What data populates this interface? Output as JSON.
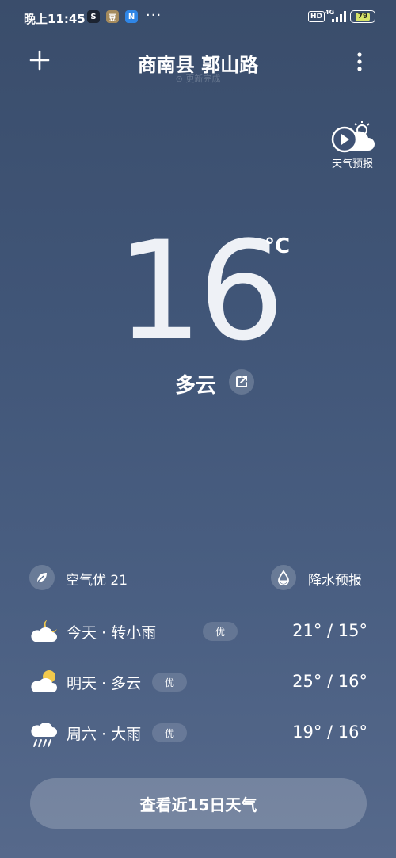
{
  "status_bar": {
    "time": "晚上11:45",
    "app_icons": [
      "S",
      "豆",
      "N"
    ],
    "more": "···",
    "hd": "HD",
    "network": "4G",
    "battery": "79"
  },
  "header": {
    "add_icon": "plus-icon",
    "title": "商南县 郭山路",
    "subtitle": "⊙ 更新完成",
    "more_icon": "more-vertical-icon"
  },
  "forecast_video": {
    "label": "天气预报",
    "icon": "play-weather-icon"
  },
  "current": {
    "temperature": "16",
    "unit": "°C",
    "condition": "多云"
  },
  "air_quality": {
    "label": "空气优 21",
    "icon": "leaf-icon"
  },
  "precipitation": {
    "label": "降水预报",
    "icon": "drop-icon"
  },
  "daily": [
    {
      "label": "今天 · 转小雨",
      "badge": "优",
      "temps": "21° / 15°",
      "icon": "moon-cloud-icon"
    },
    {
      "label": "明天 · 多云",
      "badge": "优",
      "temps": "25° / 16°",
      "icon": "sun-cloud-icon"
    },
    {
      "label": "周六 · 大雨",
      "badge": "优",
      "temps": "19° / 16°",
      "icon": "heavy-rain-icon"
    }
  ],
  "cta": {
    "label": "查看近15日天气"
  },
  "colors": {
    "accent_yellow": "#f2c94c",
    "bg_top": "#3a4d6b",
    "bg_bottom": "#56698b"
  }
}
